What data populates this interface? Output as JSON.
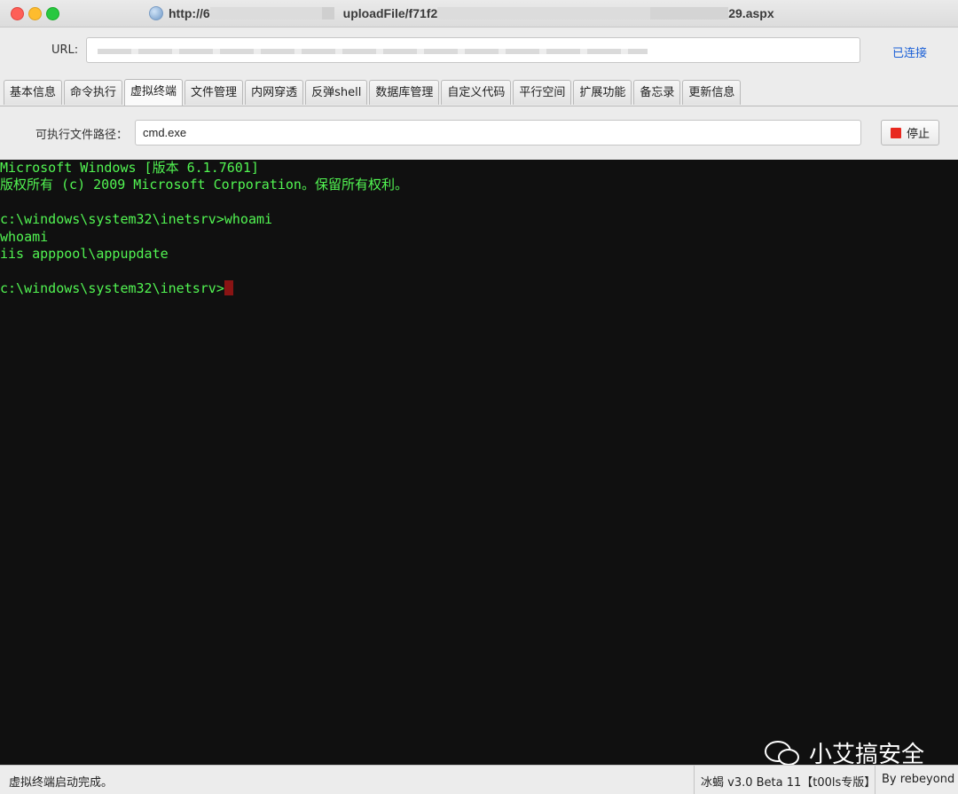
{
  "window": {
    "title_prefix": "http://6",
    "title_mid": "uploadFile/f71f2",
    "title_suffix": "29.aspx"
  },
  "url_row": {
    "label": "URL:",
    "connection_status": "已连接"
  },
  "tabs": [
    {
      "label": "基本信息",
      "active": false
    },
    {
      "label": "命令执行",
      "active": false
    },
    {
      "label": "虚拟终端",
      "active": true
    },
    {
      "label": "文件管理",
      "active": false
    },
    {
      "label": "内网穿透",
      "active": false
    },
    {
      "label": "反弹shell",
      "active": false
    },
    {
      "label": "数据库管理",
      "active": false
    },
    {
      "label": "自定义代码",
      "active": false
    },
    {
      "label": "平行空间",
      "active": false
    },
    {
      "label": "扩展功能",
      "active": false
    },
    {
      "label": "备忘录",
      "active": false
    },
    {
      "label": "更新信息",
      "active": false
    }
  ],
  "terminal_panel": {
    "path_label": "可执行文件路径：",
    "path_value": "cmd.exe",
    "stop_label": "停止"
  },
  "terminal": {
    "lines": [
      "Microsoft Windows [版本 6.1.7601]",
      "版权所有 (c) 2009 Microsoft Corporation。保留所有权利。",
      "",
      "c:\\windows\\system32\\inetsrv>whoami",
      "whoami",
      "iis apppool\\appupdate",
      "",
      "c:\\windows\\system32\\inetsrv>"
    ]
  },
  "watermark": {
    "text": "小艾搞安全"
  },
  "status_bar": {
    "message": "虚拟终端启动完成。",
    "version": "冰蝎 v3.0 Beta 11【t00ls专版】",
    "author": "By rebeyond"
  },
  "colors": {
    "terminal_bg": "#101010",
    "terminal_text": "#52f552",
    "cursor": "#8a1414",
    "stop": "#e8281f",
    "link": "#1a5fd6"
  }
}
